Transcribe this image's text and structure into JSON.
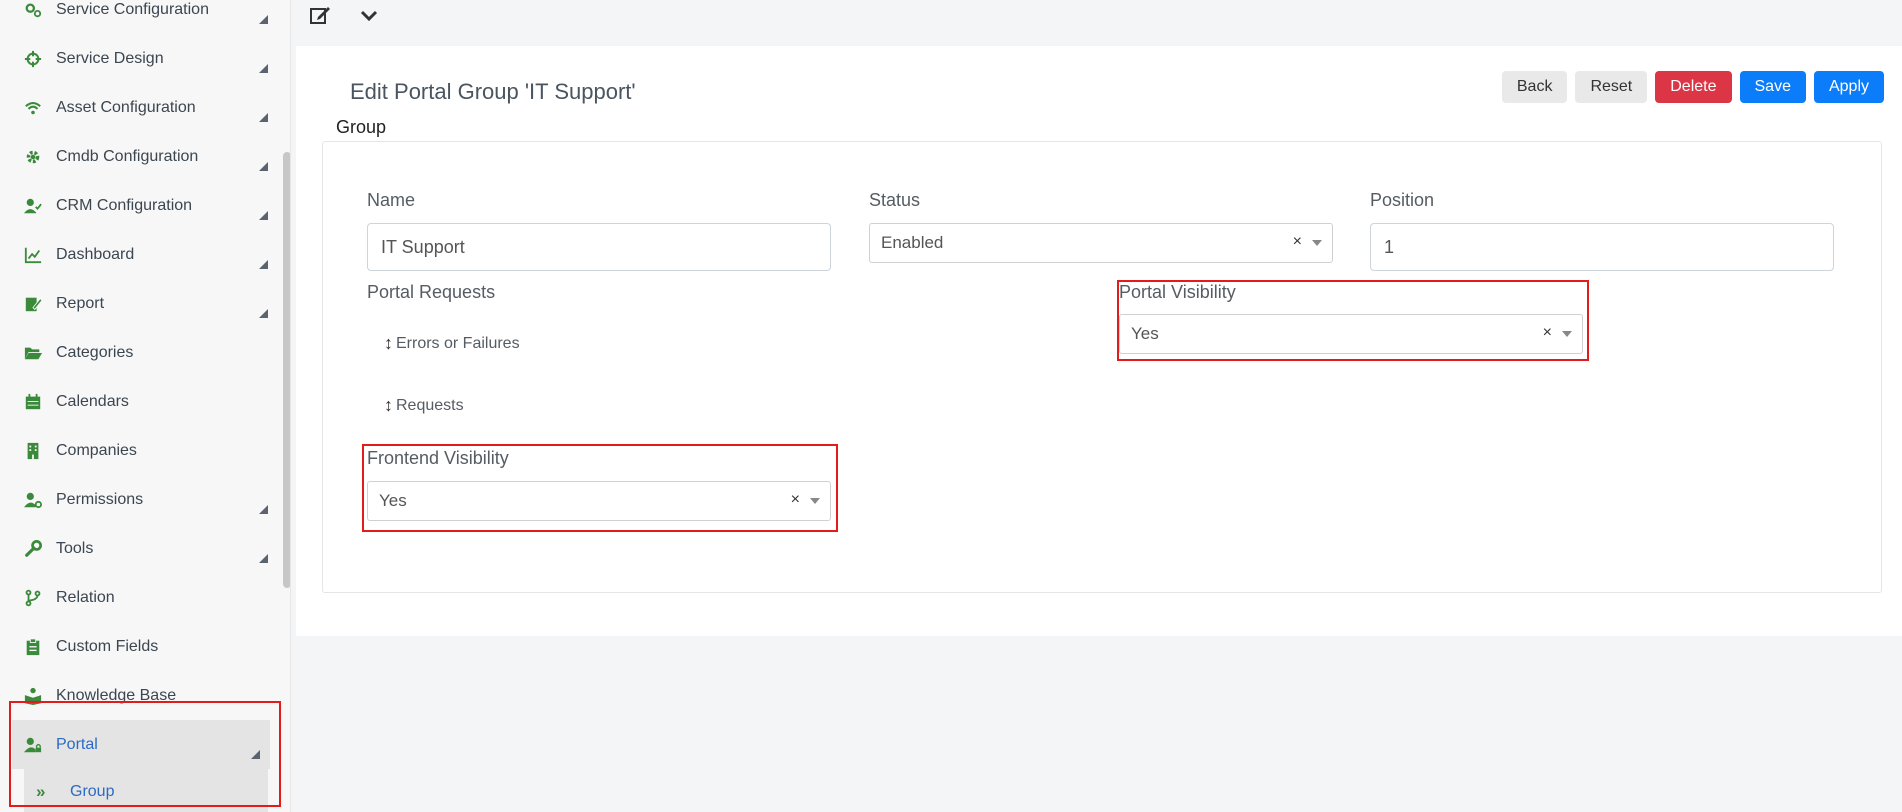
{
  "sidebar": {
    "items": [
      {
        "label": "Service Configuration",
        "icon": "gears-icon",
        "expandable": true
      },
      {
        "label": "Service Design",
        "icon": "crosshairs-icon",
        "expandable": true
      },
      {
        "label": "Asset Configuration",
        "icon": "wifi-icon",
        "expandable": true
      },
      {
        "label": "Cmdb Configuration",
        "icon": "gear-icon",
        "expandable": true
      },
      {
        "label": "CRM Configuration",
        "icon": "user-check-icon",
        "expandable": true
      },
      {
        "label": "Dashboard",
        "icon": "line-chart-icon",
        "expandable": true
      },
      {
        "label": "Report",
        "icon": "edit-report-icon",
        "expandable": true
      },
      {
        "label": "Categories",
        "icon": "folder-open-icon",
        "expandable": false
      },
      {
        "label": "Calendars",
        "icon": "calendar-icon",
        "expandable": false
      },
      {
        "label": "Companies",
        "icon": "building-icon",
        "expandable": false
      },
      {
        "label": "Permissions",
        "icon": "user-cog-icon",
        "expandable": true
      },
      {
        "label": "Tools",
        "icon": "wrench-icon",
        "expandable": true
      },
      {
        "label": "Relation",
        "icon": "code-branch-icon",
        "expandable": false
      },
      {
        "label": "Custom Fields",
        "icon": "clipboard-icon",
        "expandable": false
      },
      {
        "label": "Knowledge Base",
        "icon": "book-reader-icon",
        "expandable": false
      },
      {
        "label": "Portal",
        "icon": "user-lock-icon",
        "expandable": true
      }
    ],
    "subitem": {
      "label": "Group",
      "icon": "double-chevron-right-icon"
    }
  },
  "toolbar": {
    "edit_icon": "edit-icon",
    "dropdown_icon": "chevron-down-icon"
  },
  "main": {
    "title": "Edit Portal Group 'IT Support'",
    "section": "Group",
    "buttons": {
      "back": "Back",
      "reset": "Reset",
      "delete": "Delete",
      "save": "Save",
      "apply": "Apply"
    },
    "fields": {
      "name": {
        "label": "Name",
        "value": "IT Support"
      },
      "status": {
        "label": "Status",
        "value": "Enabled"
      },
      "position": {
        "label": "Position",
        "value": "1"
      },
      "portal_requests": {
        "label": "Portal Requests",
        "items": [
          "Errors or Failures",
          "Requests"
        ]
      },
      "portal_visibility": {
        "label": "Portal Visibility",
        "value": "Yes"
      },
      "frontend_visibility": {
        "label": "Frontend Visibility",
        "value": "Yes"
      }
    },
    "clear_symbol": "×"
  },
  "colors": {
    "accent": "#0b7dfa",
    "danger": "#dc3545",
    "icon_green": "#3b8a3b",
    "highlight": "#e21b1b",
    "active_link": "#2b6bc4"
  }
}
